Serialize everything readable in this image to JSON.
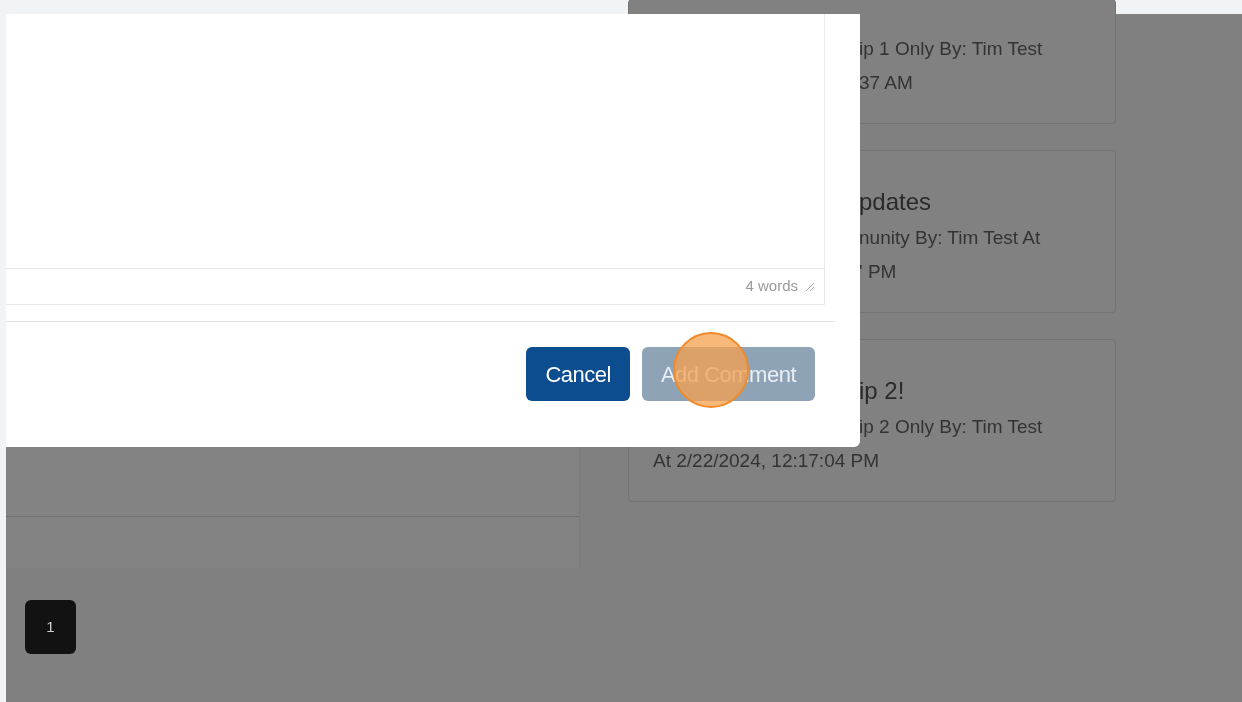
{
  "background_cards": [
    {
      "lines": [
        {
          "text": "ip 1 Only By: Tim Test",
          "cut": true,
          "kind": "meta"
        },
        {
          "text": "37 AM",
          "cut": true,
          "kind": "meta"
        }
      ]
    },
    {
      "lines": [
        {
          "text": "pdates",
          "cut": true,
          "kind": "title"
        },
        {
          "text": "nunity By: Tim Test At",
          "cut": true,
          "kind": "meta"
        },
        {
          "text": "' PM",
          "cut": true,
          "kind": "meta"
        }
      ]
    },
    {
      "lines": [
        {
          "text": "ip 2!",
          "cut": true,
          "kind": "title"
        },
        {
          "text": "ip 2 Only By: Tim Test",
          "cut": true,
          "kind": "meta"
        },
        {
          "text": "At 2/22/2024, 12:17:04 PM",
          "kind": "meta"
        }
      ]
    }
  ],
  "pagination": [
    {
      "label": "1",
      "selected": true
    }
  ],
  "modal": {
    "word_count": "4 words",
    "buttons": [
      {
        "label": "Cancel",
        "disabled": false
      },
      {
        "label": "Add Comment",
        "disabled": true
      }
    ]
  }
}
